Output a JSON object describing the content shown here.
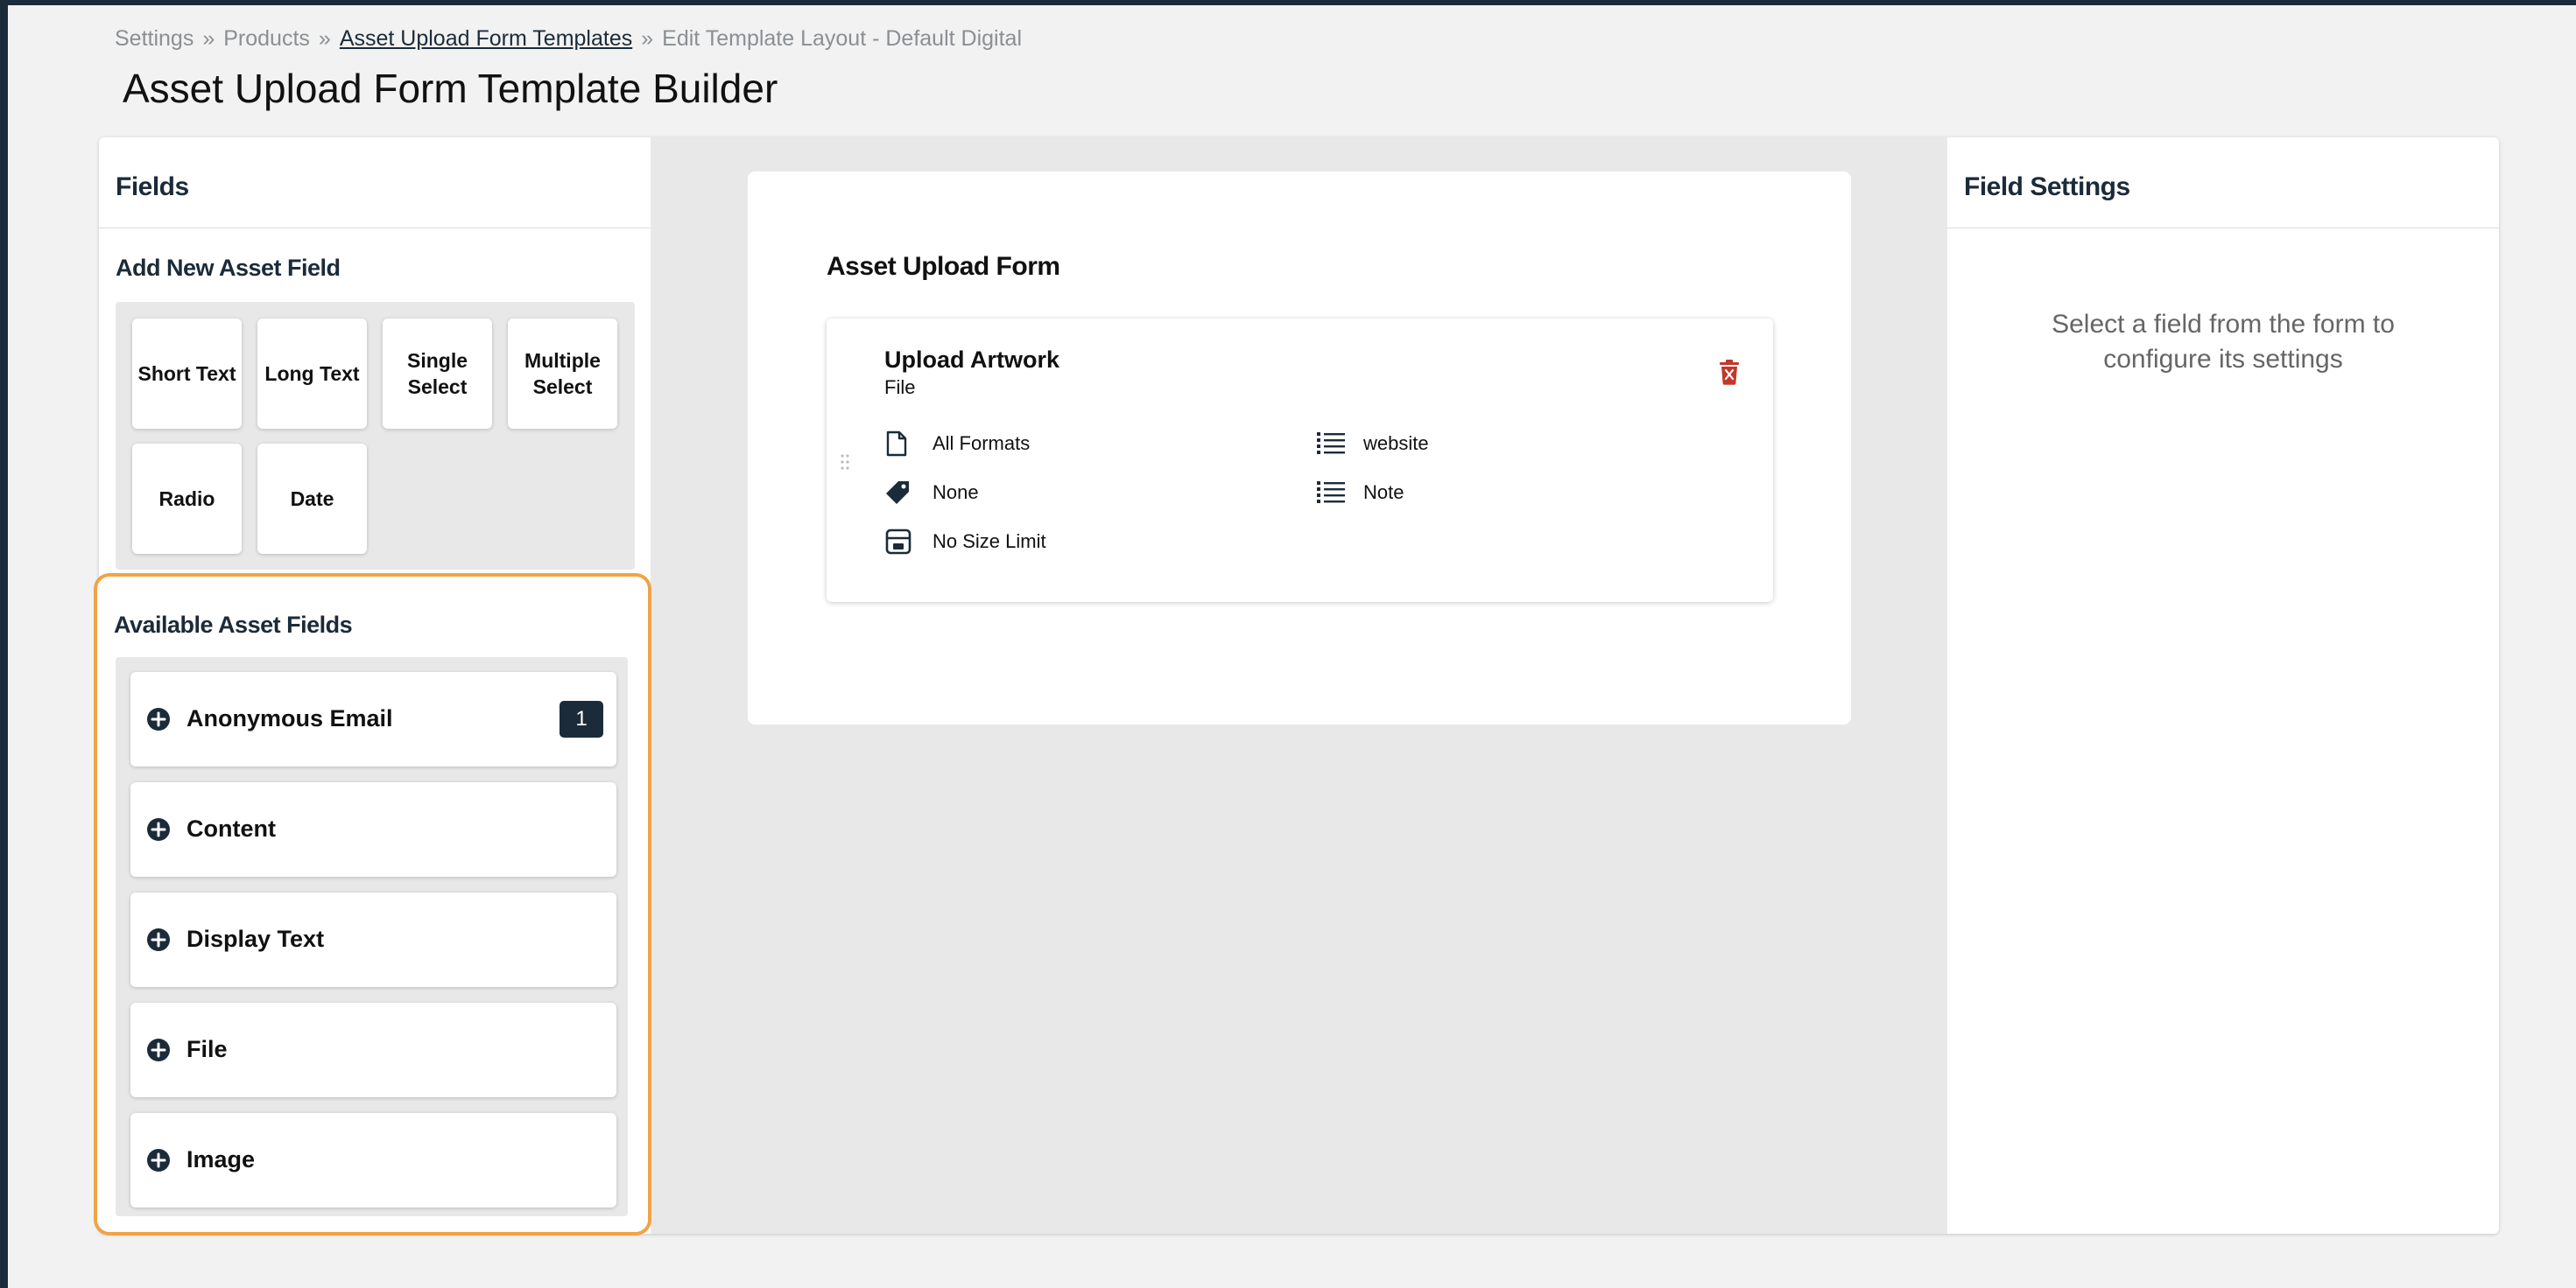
{
  "breadcrumb": {
    "items": [
      "Settings",
      "Products",
      "Asset Upload Form Templates",
      "Edit Template Layout - Default Digital"
    ],
    "separator": "»"
  },
  "page_title": "Asset Upload Form Template Builder",
  "fields_panel": {
    "title": "Fields",
    "add_new_title": "Add New Asset Field",
    "tiles": [
      "Short Text",
      "Long Text",
      "Single Select",
      "Multiple Select",
      "Radio",
      "Date"
    ],
    "available_title": "Available Asset Fields",
    "available": [
      {
        "label": "Anonymous Email",
        "badge": "1"
      },
      {
        "label": "Content"
      },
      {
        "label": "Display Text"
      },
      {
        "label": "File"
      },
      {
        "label": "Image"
      }
    ]
  },
  "form": {
    "title": "Asset Upload Form",
    "field": {
      "title": "Upload Artwork",
      "type": "File",
      "formats": "All Formats",
      "tag": "None",
      "size_limit": "No Size Limit",
      "list_1": "website",
      "list_2": "Note"
    }
  },
  "settings_panel": {
    "title": "Field Settings",
    "hint": "Select a field from the form to configure its settings"
  },
  "colors": {
    "navy": "#1c2b39",
    "highlight_orange": "#f0a347",
    "delete_red": "#c0392b"
  },
  "icons": [
    "plus-circle-icon",
    "file-icon",
    "tag-icon",
    "save-icon",
    "list-icon",
    "trash-icon",
    "drag-handle-icon"
  ]
}
